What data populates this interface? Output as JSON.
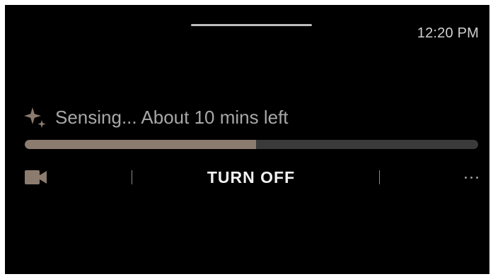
{
  "status_bar": {
    "time": "12:20 PM"
  },
  "sensing": {
    "icon": "sparkle-icon",
    "status_text": "Sensing... About 10 mins left",
    "progress": 0.51
  },
  "controls": {
    "camera_icon": "video-camera-icon",
    "turn_off_label": "TURN OFF",
    "more_icon": "more-options-icon"
  },
  "colors": {
    "background": "#000000",
    "accent": "#8c7b6f",
    "track": "#3a3a3a"
  }
}
